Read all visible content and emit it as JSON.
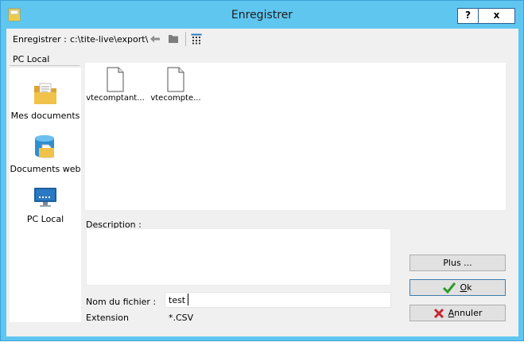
{
  "window": {
    "title": "Enregistrer",
    "help_label": "?",
    "close_label": "x"
  },
  "pathbar": {
    "label": "Enregistrer :",
    "path": "c:\\tite-live\\export\\"
  },
  "locations": {
    "header": "PC Local",
    "items": [
      {
        "label": "Mes documents",
        "icon": "documents-folder-icon"
      },
      {
        "label": "Documents web",
        "icon": "web-documents-icon"
      },
      {
        "label": "PC Local",
        "icon": "local-computer-icon"
      }
    ]
  },
  "files": [
    {
      "name": "vtecomptant..."
    },
    {
      "name": "vtecompte..."
    }
  ],
  "form": {
    "description_label": "Description :",
    "description_value": "",
    "filename_label": "Nom du fichier :",
    "filename_value": "test",
    "extension_label": "Extension",
    "extension_value": "*.CSV"
  },
  "buttons": {
    "more": "Plus ...",
    "ok_mnemonic": "O",
    "ok_rest": "k",
    "cancel_mnemonic": "A",
    "cancel_rest": "nnuler"
  },
  "colors": {
    "titlebar": "#5fc6f0",
    "ok_check": "#2a9a2a",
    "cancel_x": "#c8262f"
  }
}
